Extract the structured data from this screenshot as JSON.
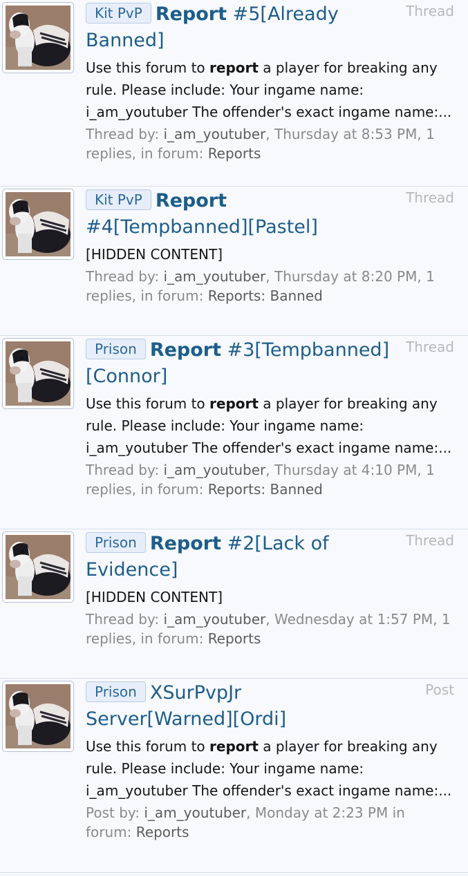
{
  "results": [
    {
      "prefix": "Kit PvP",
      "title_bold": "Report",
      "title_rest": " #5[Already Banned]",
      "content_type": "Thread",
      "snippet_parts": [
        "Use this forum to ",
        "report",
        " a player for breaking any rule. Please include: Your ingame name: i_am_youtuber The offender's exact ingame name:..."
      ],
      "meta_by": "Thread by: ",
      "author": "i_am_youtuber",
      "meta_time": ", Thursday at 8:53 PM, 1 replies, in forum: ",
      "forum": "Reports"
    },
    {
      "prefix": "Kit PvP",
      "title_bold": "Report",
      "title_rest": " #4[Tempbanned][Pastel]",
      "content_type": "Thread",
      "snippet_parts": [
        "[HIDDEN CONTENT]",
        "",
        ""
      ],
      "meta_by": "Thread by: ",
      "author": "i_am_youtuber",
      "meta_time": ", Thursday at 8:20 PM, 1 replies, in forum: ",
      "forum": "Reports: Banned"
    },
    {
      "prefix": "Prison",
      "title_bold": "Report",
      "title_rest": " #3[Tempbanned][Connor]",
      "content_type": "Thread",
      "snippet_parts": [
        "Use this forum to ",
        "report",
        " a player for breaking any rule. Please include: Your ingame name: i_am_youtuber The offender's exact ingame name:..."
      ],
      "meta_by": "Thread by: ",
      "author": "i_am_youtuber",
      "meta_time": ", Thursday at 4:10 PM, 1 replies, in forum: ",
      "forum": "Reports: Banned"
    },
    {
      "prefix": "Prison",
      "title_bold": "Report",
      "title_rest": " #2[Lack of Evidence]",
      "content_type": "Thread",
      "snippet_parts": [
        "[HIDDEN CONTENT]",
        "",
        ""
      ],
      "meta_by": "Thread by: ",
      "author": "i_am_youtuber",
      "meta_time": ", Wednesday at 1:57 PM, 1 replies, in forum: ",
      "forum": "Reports"
    },
    {
      "prefix": "Prison",
      "title_bold": "",
      "title_rest": "XSurPvpJr Server[Warned][Ordi]",
      "content_type": "Post",
      "snippet_parts": [
        "Use this forum to ",
        "report",
        " a player for breaking any rule. Please include: Your ingame name: i_am_youtuber The offender's exact ingame name:..."
      ],
      "meta_by": "Post by: ",
      "author": "i_am_youtuber",
      "meta_time": ", Monday at 2:23 PM in forum: ",
      "forum": "Reports"
    }
  ],
  "colors": {
    "link": "#1c5d8a",
    "prefix_bg": "#e7eef9",
    "muted": "#8a8a8a",
    "divider": "#d7dfee"
  }
}
